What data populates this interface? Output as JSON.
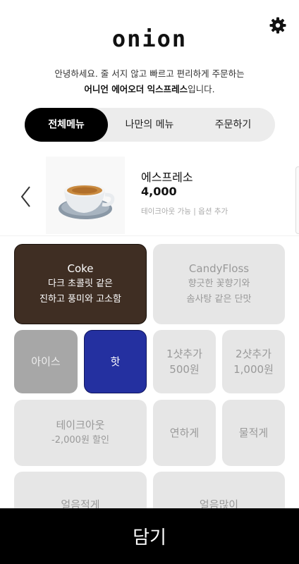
{
  "header": {
    "logo": "onion",
    "greeting_line1": "안녕하세요. 줄 서지 않고 빠르고 편리하게 주문하는",
    "greeting_line2_bold": "어니언 에어오더 익스프레스",
    "greeting_line2_tail": "입니다."
  },
  "tabs": [
    {
      "label": "전체메뉴",
      "active": true
    },
    {
      "label": "나만의 메뉴",
      "active": false
    },
    {
      "label": "주문하기",
      "active": false
    }
  ],
  "product": {
    "name": "에스프레소",
    "price": "4,000",
    "options_hint": "테이크아웃 가능 | 옵션 추가"
  },
  "options": {
    "coke": {
      "title": "Coke",
      "sub1": "다크 초콜릿 같은",
      "sub2": "진하고 풍미와 고소함"
    },
    "candy": {
      "title": "CandyFloss",
      "sub1": "향긋한 꽃향기와",
      "sub2": "솜사탕 같은 단맛"
    },
    "ice": {
      "label": "아이스"
    },
    "hot": {
      "label": "핫"
    },
    "shot1": {
      "line1": "1샷추가",
      "line2": "500원"
    },
    "shot2": {
      "line1": "2샷추가",
      "line2": "1,000원"
    },
    "takeout": {
      "title": "테이크아웃",
      "sub": "-2,000원 할인"
    },
    "weak": {
      "label": "연하게"
    },
    "watery": {
      "label": "물적게"
    },
    "iceless": {
      "label": "얼음적게"
    },
    "icemore": {
      "label": "얼음많이"
    }
  },
  "cart": {
    "label": "담기"
  },
  "colors": {
    "selected_bean": "#3f2e23",
    "selected_temp": "#2430a0",
    "unselected": "#e6e6e6"
  }
}
